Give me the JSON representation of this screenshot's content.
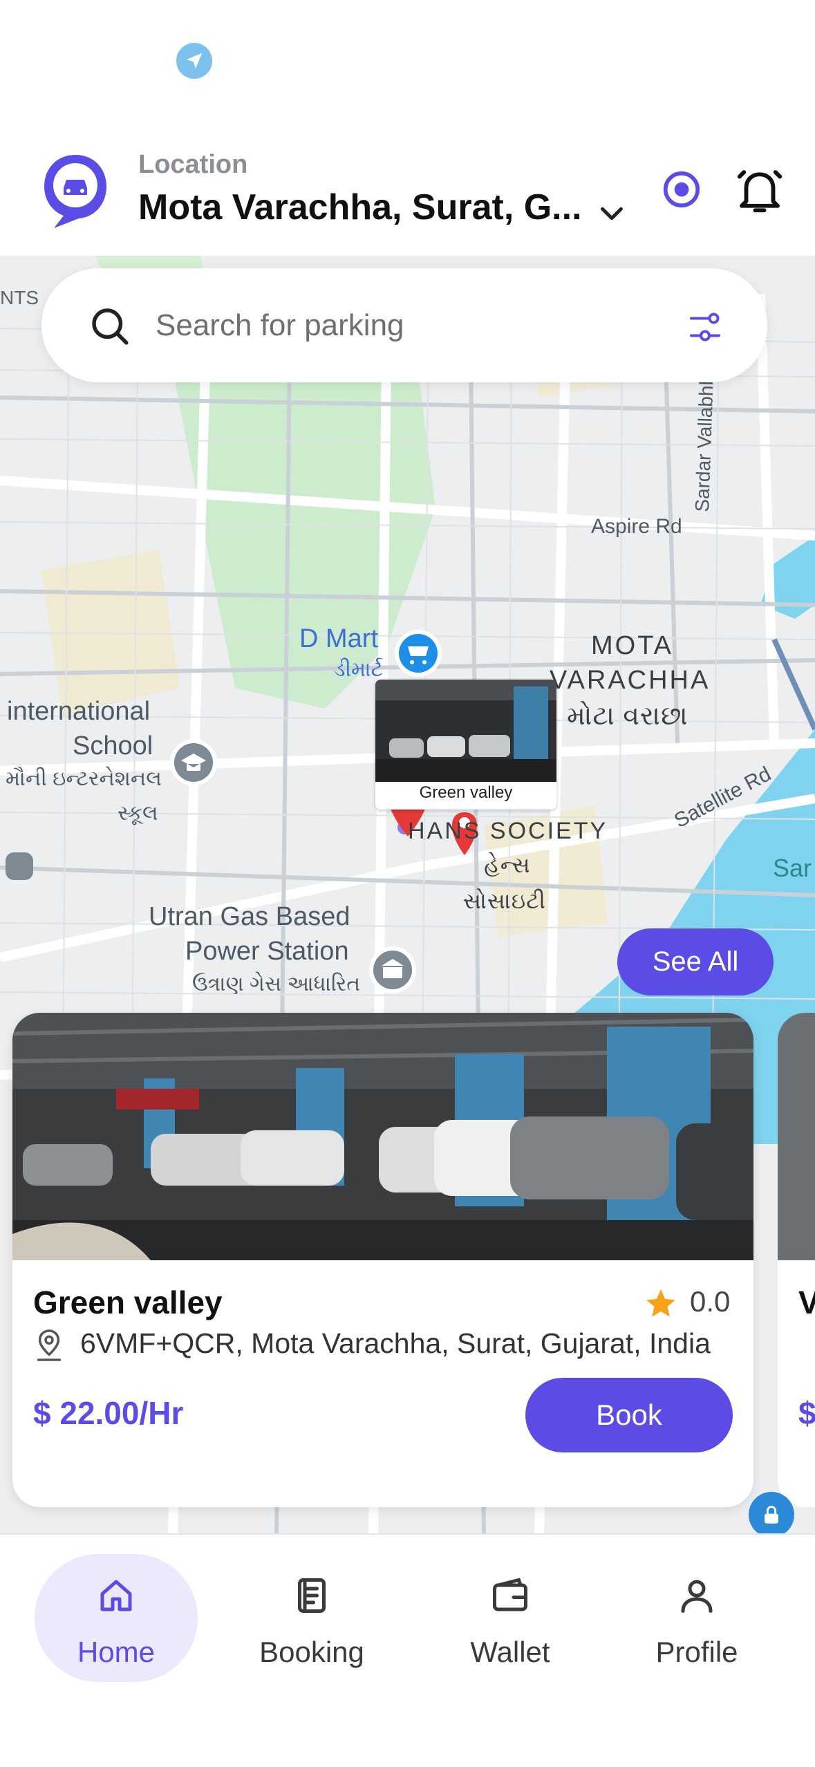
{
  "header": {
    "location_label": "Location",
    "location_value": "Mota Varachha, Surat, G...",
    "icons": [
      "app-logo",
      "chevron-down-icon",
      "my-location-icon",
      "bell-icon"
    ]
  },
  "search": {
    "placeholder": "Search for parking",
    "icons": [
      "search-icon",
      "filter-icon"
    ]
  },
  "map": {
    "labels": {
      "ints": "NTS",
      "aspire": "Aspire Rd",
      "sardar": "Sardar Vallabhbhai Patel Rd",
      "dmart": "D Mart",
      "dmart_gu": "ડીમાર્ટ",
      "mota": "MOTA",
      "varachha": "VARACHHA",
      "mota_gu": "મોટા વરાછા",
      "intl1": "international",
      "intl2": "School",
      "intl_gu1": "મૌની ઇન્ટરનેશનલ",
      "intl_gu2": "સ્કૂલ",
      "hans": "HANS SOCIETY",
      "hans_gu1": "હેન્સ",
      "hans_gu2": "સોસાઇટી",
      "satellite": "Satellite Rd",
      "utran1": "Utran Gas Based",
      "utran2": "Power Station",
      "utran_gu": "ઉત્રાણ ગેસ આધારિત",
      "sar": "Sar"
    },
    "marker_card_name": "Green valley",
    "see_all_label": "See All"
  },
  "parking_cards": [
    {
      "name": "Green valley",
      "rating": "0.0",
      "address": "6VMF+QCR, Mota Varachha, Surat, Gujarat, India",
      "price": "$ 22.00/Hr",
      "book_label": "Book"
    },
    {
      "name": "V",
      "price": "$"
    }
  ],
  "bottom_nav": {
    "items": [
      {
        "label": "Home",
        "active": true
      },
      {
        "label": "Booking",
        "active": false
      },
      {
        "label": "Wallet",
        "active": false
      },
      {
        "label": "Profile",
        "active": false
      }
    ]
  },
  "colors": {
    "accent": "#5b4ce6",
    "accent_soft": "#ece9fd",
    "map_water": "#7fd3ee",
    "map_green": "#cdeccd",
    "map_bg": "#eceef0",
    "marker_red": "#e53935"
  }
}
